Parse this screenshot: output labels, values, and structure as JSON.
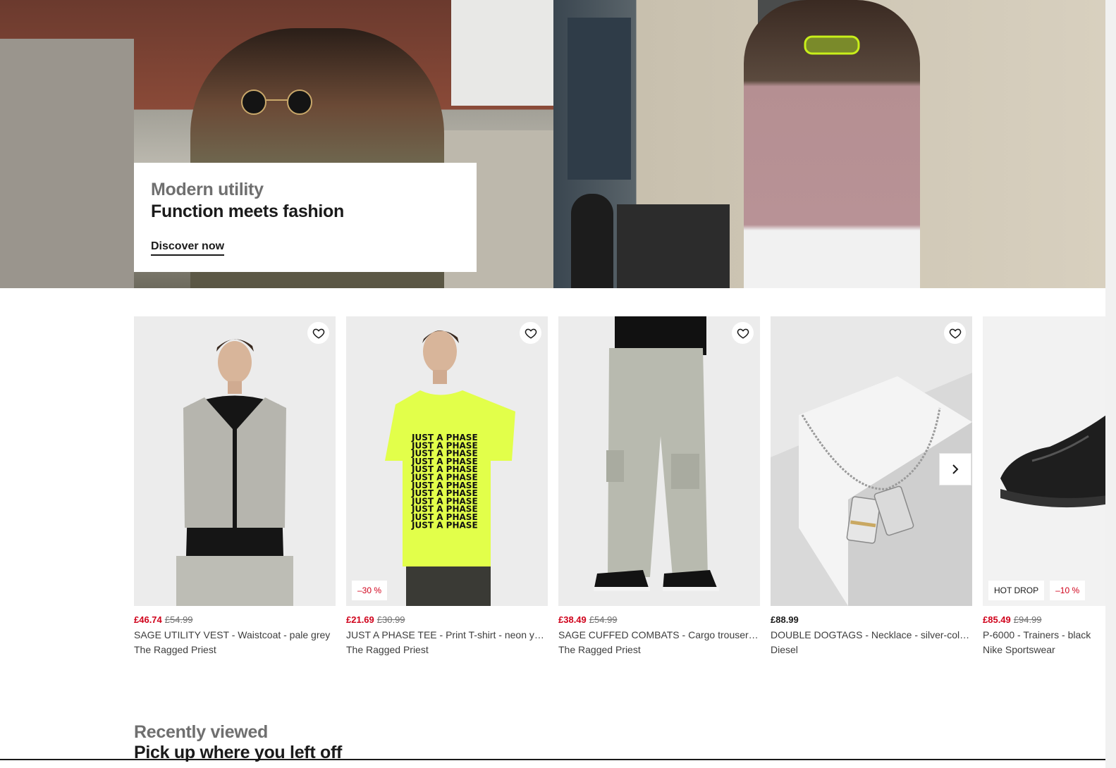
{
  "hero": {
    "eyebrow": "Modern utility",
    "title": "Function meets fashion",
    "cta": "Discover now"
  },
  "products": [
    {
      "price": "£46.74",
      "old_price": "£54.99",
      "name": "SAGE UTILITY VEST - Waistcoat - pale grey",
      "brand": "The Ragged Priest",
      "badges": [],
      "art": "vest"
    },
    {
      "price": "£21.69",
      "old_price": "£30.99",
      "name": "JUST A PHASE TEE - Print T-shirt - neon y…",
      "brand": "The Ragged Priest",
      "badges": [
        "–30 %"
      ],
      "art": "tee",
      "print": "JUST A PHASE"
    },
    {
      "price": "£38.49",
      "old_price": "£54.99",
      "name": "SAGE CUFFED COMBATS - Cargo trouser…",
      "brand": "The Ragged Priest",
      "badges": [],
      "art": "combats"
    },
    {
      "price": "£88.99",
      "old_price": "",
      "name": "DOUBLE DOGTAGS - Necklace - silver-col…",
      "brand": "Diesel",
      "badges": [],
      "art": "necklace"
    },
    {
      "price": "£85.49",
      "old_price": "£94.99",
      "name": "P-6000 - Trainers - black",
      "brand": "Nike Sportswear",
      "badges": [
        "HOT DROP",
        "–10 %"
      ],
      "art": "trainer"
    }
  ],
  "section": {
    "eyebrow": "Recently viewed",
    "title": "Pick up where you left off"
  },
  "icons": {
    "favourite": "heart-outline-icon",
    "next": "chevron-right-icon"
  },
  "colors": {
    "sale": "#d0021b",
    "text": "#1a1a1a",
    "muted": "#6f6f6f"
  }
}
